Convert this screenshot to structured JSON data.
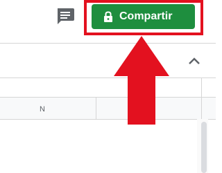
{
  "toolbar": {
    "comments_icon": "comment-icon",
    "share_button": {
      "label": "Compartir",
      "icon": "lock-icon",
      "color": "#1e8e3e"
    }
  },
  "annotation": {
    "color": "#e3111f",
    "shape": "arrow-up-with-box"
  },
  "panel": {
    "collapse_icon": "chevron-up-icon"
  },
  "spreadsheet": {
    "visible_columns": [
      "N"
    ]
  }
}
